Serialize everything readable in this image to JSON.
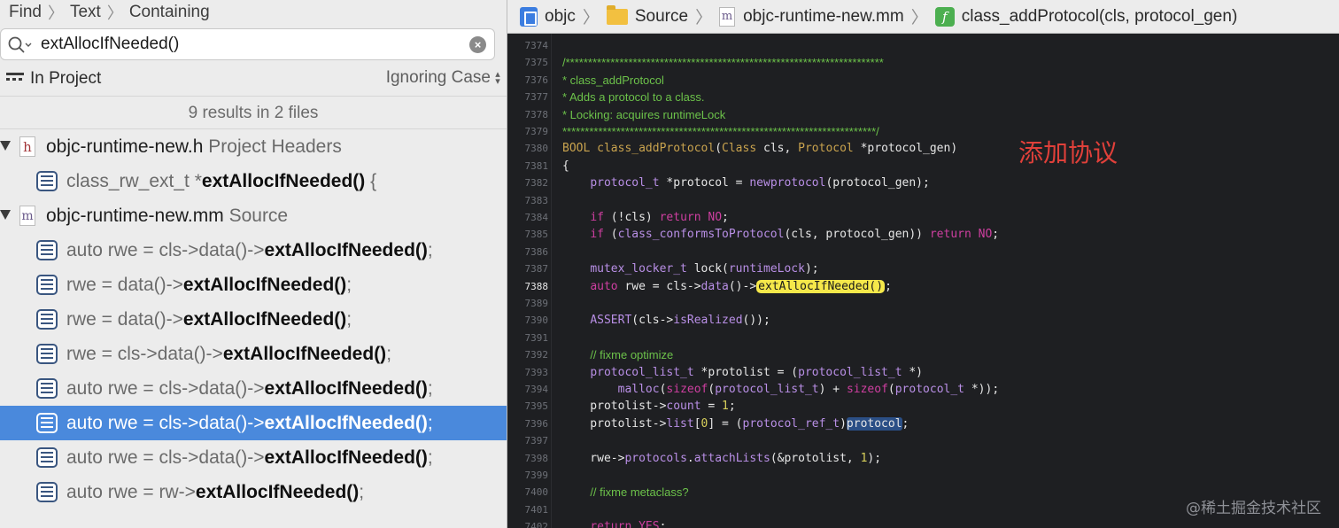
{
  "find_navigator": {
    "breadcrumb": [
      "Find",
      "Text",
      "Containing"
    ],
    "search": {
      "query": "extAllocIfNeeded()"
    },
    "scope_label": "In Project",
    "case_option": "Ignoring Case",
    "summary": "9 results in 2 files",
    "groups": [
      {
        "icon": "h",
        "file": "objc-runtime-new.h",
        "kind": "Project Headers",
        "results": [
          {
            "pre": "class_rw_ext_t *",
            "match": "extAllocIfNeeded()",
            "post": " {"
          }
        ]
      },
      {
        "icon": "m",
        "file": "objc-runtime-new.mm",
        "kind": "Source",
        "results": [
          {
            "pre": "auto rwe = cls->data()->",
            "match": "extAllocIfNeeded()",
            "post": ";"
          },
          {
            "pre": "rwe = data()->",
            "match": "extAllocIfNeeded()",
            "post": ";"
          },
          {
            "pre": "rwe = data()->",
            "match": "extAllocIfNeeded()",
            "post": ";"
          },
          {
            "pre": "rwe = cls->data()->",
            "match": "extAllocIfNeeded()",
            "post": ";"
          },
          {
            "pre": "auto rwe = cls->data()->",
            "match": "extAllocIfNeeded()",
            "post": ";"
          },
          {
            "pre": "auto rwe = cls->data()->",
            "match": "extAllocIfNeeded()",
            "post": ";",
            "selected": true
          },
          {
            "pre": "auto rwe = cls->data()->",
            "match": "extAllocIfNeeded()",
            "post": ";"
          },
          {
            "pre": "auto rwe = rw->",
            "match": "extAllocIfNeeded()",
            "post": ";"
          }
        ]
      }
    ]
  },
  "jump_bar": {
    "project": "objc",
    "folder": "Source",
    "file": "objc-runtime-new.mm",
    "symbol": "class_addProtocol(cls, protocol_gen)"
  },
  "editor": {
    "current_line": "7388",
    "lines": [
      {
        "n": "7374",
        "t": [
          [
            "",
            ""
          ]
        ]
      },
      {
        "n": "7375",
        "t": [
          [
            "com",
            "/***********************************************************************"
          ]
        ]
      },
      {
        "n": "7376",
        "t": [
          [
            "com",
            "* class_addProtocol"
          ]
        ]
      },
      {
        "n": "7377",
        "t": [
          [
            "com",
            "* Adds a protocol to a class."
          ]
        ]
      },
      {
        "n": "7378",
        "t": [
          [
            "com",
            "* Locking: acquires runtimeLock"
          ]
        ]
      },
      {
        "n": "7379",
        "t": [
          [
            "com",
            "**********************************************************************/"
          ]
        ]
      },
      {
        "n": "7380",
        "t": [
          [
            "typ",
            "BOOL "
          ],
          [
            "fn",
            "class_addProtocol"
          ],
          [
            "",
            "("
          ],
          [
            "typ",
            "Class"
          ],
          [
            "",
            " cls, "
          ],
          [
            "typ",
            "Protocol"
          ],
          [
            "",
            " *protocol_gen)"
          ]
        ]
      },
      {
        "n": "7381",
        "t": [
          [
            "",
            "{"
          ]
        ]
      },
      {
        "n": "7382",
        "t": [
          [
            "",
            "    "
          ],
          [
            "ty2",
            "protocol_t"
          ],
          [
            "",
            " *protocol = "
          ],
          [
            "call",
            "newprotocol"
          ],
          [
            "",
            "(protocol_gen);"
          ]
        ]
      },
      {
        "n": "7383",
        "t": [
          [
            "",
            ""
          ]
        ]
      },
      {
        "n": "7384",
        "t": [
          [
            "",
            "    "
          ],
          [
            "kw",
            "if"
          ],
          [
            "",
            " (!cls) "
          ],
          [
            "kw",
            "return"
          ],
          [
            "",
            " "
          ],
          [
            "lit",
            "NO"
          ],
          [
            "",
            ";"
          ]
        ]
      },
      {
        "n": "7385",
        "t": [
          [
            "",
            "    "
          ],
          [
            "kw",
            "if"
          ],
          [
            "",
            " ("
          ],
          [
            "call",
            "class_conformsToProtocol"
          ],
          [
            "",
            "(cls, protocol_gen)) "
          ],
          [
            "kw",
            "return"
          ],
          [
            "",
            " "
          ],
          [
            "lit",
            "NO"
          ],
          [
            "",
            ";"
          ]
        ]
      },
      {
        "n": "7386",
        "t": [
          [
            "",
            ""
          ]
        ]
      },
      {
        "n": "7387",
        "t": [
          [
            "",
            "    "
          ],
          [
            "ty2",
            "mutex_locker_t"
          ],
          [
            "",
            " lock("
          ],
          [
            "ty2",
            "runtimeLock"
          ],
          [
            "",
            ");"
          ]
        ]
      },
      {
        "n": "7388",
        "t": [
          [
            "",
            "    "
          ],
          [
            "kw",
            "auto"
          ],
          [
            "",
            " rwe = cls->"
          ],
          [
            "call",
            "data"
          ],
          [
            "",
            "()->"
          ],
          [
            "hly",
            "extAllocIfNeeded()"
          ],
          [
            "",
            ";"
          ]
        ]
      },
      {
        "n": "7389",
        "t": [
          [
            "",
            ""
          ]
        ]
      },
      {
        "n": "7390",
        "t": [
          [
            "",
            "    "
          ],
          [
            "call",
            "ASSERT"
          ],
          [
            "",
            "(cls->"
          ],
          [
            "call",
            "isRealized"
          ],
          [
            "",
            "());"
          ]
        ]
      },
      {
        "n": "7391",
        "t": [
          [
            "",
            ""
          ]
        ]
      },
      {
        "n": "7392",
        "t": [
          [
            "",
            "    "
          ],
          [
            "com",
            "// fixme optimize"
          ]
        ]
      },
      {
        "n": "7393",
        "t": [
          [
            "",
            "    "
          ],
          [
            "ty2",
            "protocol_list_t"
          ],
          [
            "",
            " *protolist = ("
          ],
          [
            "ty2",
            "protocol_list_t"
          ],
          [
            "",
            " *)"
          ]
        ]
      },
      {
        "n": "7394",
        "t": [
          [
            "",
            "        "
          ],
          [
            "call",
            "malloc"
          ],
          [
            "",
            "("
          ],
          [
            "kw",
            "sizeof"
          ],
          [
            "",
            "("
          ],
          [
            "ty2",
            "protocol_list_t"
          ],
          [
            "",
            ") + "
          ],
          [
            "kw",
            "sizeof"
          ],
          [
            "",
            "("
          ],
          [
            "ty2",
            "protocol_t"
          ],
          [
            "",
            " *));"
          ]
        ]
      },
      {
        "n": "7395",
        "t": [
          [
            "",
            "    protolist->"
          ],
          [
            "call",
            "count"
          ],
          [
            "",
            " = "
          ],
          [
            "num",
            "1"
          ],
          [
            "",
            ";"
          ]
        ]
      },
      {
        "n": "7396",
        "t": [
          [
            "",
            "    protolist->"
          ],
          [
            "call",
            "list"
          ],
          [
            "",
            "["
          ],
          [
            "num",
            "0"
          ],
          [
            "",
            "] = ("
          ],
          [
            "ty2",
            "protocol_ref_t"
          ],
          [
            "",
            ")"
          ],
          [
            "hlb",
            "protocol"
          ],
          [
            "",
            ";"
          ]
        ]
      },
      {
        "n": "7397",
        "t": [
          [
            "",
            ""
          ]
        ]
      },
      {
        "n": "7398",
        "t": [
          [
            "",
            "    rwe->"
          ],
          [
            "call",
            "protocols"
          ],
          [
            "",
            "."
          ],
          [
            "call",
            "attachLists"
          ],
          [
            "",
            "(&protolist, "
          ],
          [
            "num",
            "1"
          ],
          [
            "",
            ");"
          ]
        ]
      },
      {
        "n": "7399",
        "t": [
          [
            "",
            ""
          ]
        ]
      },
      {
        "n": "7400",
        "t": [
          [
            "",
            "    "
          ],
          [
            "com",
            "// fixme metaclass?"
          ]
        ]
      },
      {
        "n": "7401",
        "t": [
          [
            "",
            ""
          ]
        ]
      },
      {
        "n": "7402",
        "t": [
          [
            "",
            "    "
          ],
          [
            "kw",
            "return"
          ],
          [
            "",
            " "
          ],
          [
            "lit",
            "YES"
          ],
          [
            "",
            ";"
          ]
        ]
      }
    ]
  },
  "annotation": "添加协议",
  "watermark": "@稀土掘金技术社区"
}
